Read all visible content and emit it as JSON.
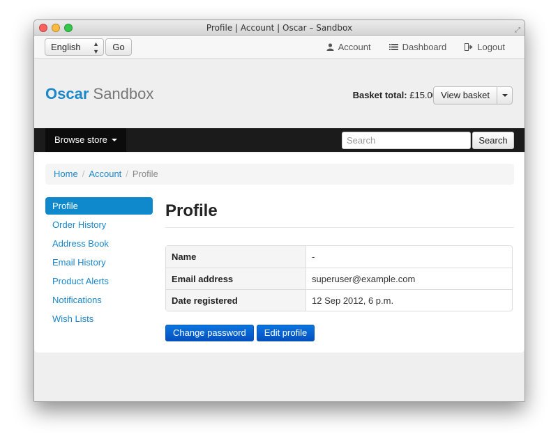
{
  "window": {
    "title": "Profile | Account | Oscar – Sandbox"
  },
  "topbar": {
    "language": "English",
    "go_label": "Go",
    "nav": [
      {
        "label": "Account",
        "icon": "user-icon"
      },
      {
        "label": "Dashboard",
        "icon": "list-icon"
      },
      {
        "label": "Logout",
        "icon": "logout-icon"
      }
    ]
  },
  "header": {
    "brand_primary": "Oscar",
    "brand_secondary": "Sandbox",
    "basket_total_label": "Basket total:",
    "basket_total_value": "£15.00",
    "view_basket_label": "View basket"
  },
  "navbar": {
    "browse_label": "Browse store",
    "search_placeholder": "Search",
    "search_button": "Search"
  },
  "breadcrumb": [
    "Home",
    "Account",
    "Profile"
  ],
  "sidebar": {
    "items": [
      {
        "label": "Profile",
        "active": true
      },
      {
        "label": "Order History"
      },
      {
        "label": "Address Book"
      },
      {
        "label": "Email History"
      },
      {
        "label": "Product Alerts"
      },
      {
        "label": "Notifications"
      },
      {
        "label": "Wish Lists"
      }
    ]
  },
  "main": {
    "title": "Profile",
    "rows": [
      {
        "key": "Name",
        "value": "-"
      },
      {
        "key": "Email address",
        "value": "superuser@example.com"
      },
      {
        "key": "Date registered",
        "value": "12 Sep 2012, 6 p.m."
      }
    ],
    "change_password_label": "Change password",
    "edit_profile_label": "Edit profile"
  },
  "colors": {
    "brand_blue": "#1b88c9",
    "active_item_bg": "#0f88cc",
    "navbar_bg": "#1b1b1b",
    "primary_button": "#0450c0"
  }
}
